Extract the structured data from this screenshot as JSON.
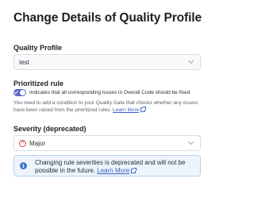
{
  "dialog": {
    "title": "Change Details of Quality Profile"
  },
  "quality_profile": {
    "label": "Quality Profile",
    "value": "test"
  },
  "prioritized_rule": {
    "label": "Prioritized rule",
    "toggle_on": true,
    "toggle_label": "Indicates that all corresponding issues in Overall Code should be fixed",
    "help_text": "You need to add a condition to your Quality Gate that checks whether any issues have been raised from the prioritized rules.",
    "learn_more": "Learn More"
  },
  "severity": {
    "label": "Severity (deprecated)",
    "value": "Major",
    "icon": "major-severity-icon"
  },
  "notice": {
    "text": "Changing rule severities is deprecated and will not be possible in the future.",
    "learn_more": "Learn More",
    "icon": "info-icon"
  },
  "colors": {
    "accent": "#5c67cd",
    "link": "#3a62c7",
    "severity_major": "#d64545",
    "notice_bg": "#eef4fc",
    "notice_border": "#b7cfee"
  }
}
